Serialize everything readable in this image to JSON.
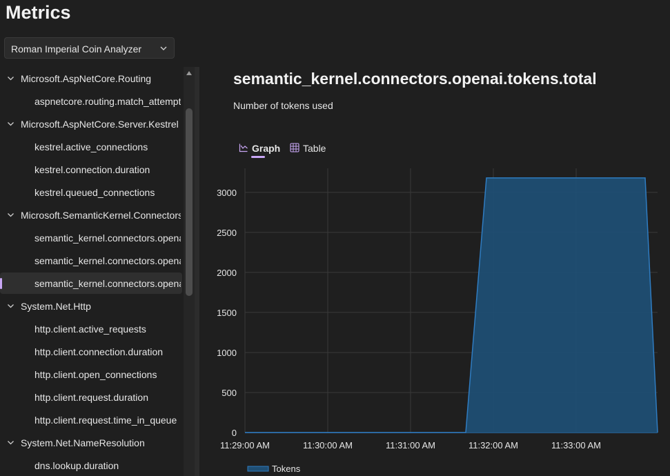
{
  "header": {
    "title": "Metrics"
  },
  "resource_select": {
    "value": "Roman Imperial Coin Analyzer"
  },
  "sidebar": {
    "items": [
      {
        "type": "group",
        "label": "Microsoft.AspNetCore.Routing"
      },
      {
        "type": "leaf",
        "label": "aspnetcore.routing.match_attempts"
      },
      {
        "type": "group",
        "label": "Microsoft.AspNetCore.Server.Kestrel"
      },
      {
        "type": "leaf",
        "label": "kestrel.active_connections"
      },
      {
        "type": "leaf",
        "label": "kestrel.connection.duration"
      },
      {
        "type": "leaf",
        "label": "kestrel.queued_connections"
      },
      {
        "type": "group",
        "label": "Microsoft.SemanticKernel.Connectors.OpenAI"
      },
      {
        "type": "leaf",
        "label": "semantic_kernel.connectors.openai.tokens.prompt"
      },
      {
        "type": "leaf",
        "label": "semantic_kernel.connectors.openai.tokens.completion"
      },
      {
        "type": "leaf",
        "label": "semantic_kernel.connectors.openai.tokens.total",
        "selected": true
      },
      {
        "type": "group",
        "label": "System.Net.Http"
      },
      {
        "type": "leaf",
        "label": "http.client.active_requests"
      },
      {
        "type": "leaf",
        "label": "http.client.connection.duration"
      },
      {
        "type": "leaf",
        "label": "http.client.open_connections"
      },
      {
        "type": "leaf",
        "label": "http.client.request.duration"
      },
      {
        "type": "leaf",
        "label": "http.client.request.time_in_queue"
      },
      {
        "type": "group",
        "label": "System.Net.NameResolution"
      },
      {
        "type": "leaf",
        "label": "dns.lookup.duration"
      }
    ]
  },
  "metric": {
    "title": "semantic_kernel.connectors.openai.tokens.total",
    "description": "Number of tokens used"
  },
  "tabs": {
    "graph": "Graph",
    "table": "Table",
    "active": "graph"
  },
  "colors": {
    "accent": "#c9a7f5",
    "series_fill": "#1f4e73",
    "series_line": "#2f7cc1",
    "grid": "#3a3a3a"
  },
  "chart_data": {
    "type": "area",
    "x": [
      "11:29:00 AM",
      "11:31:40 AM",
      "11:31:55 AM",
      "11:33:50 AM",
      "11:34:05 AM"
    ],
    "x_ticks": [
      "11:29:00 AM",
      "11:30:00 AM",
      "11:31:00 AM",
      "11:32:00 AM",
      "11:33:00 AM"
    ],
    "y_ticks": [
      0,
      500,
      1000,
      1500,
      2000,
      2500,
      3000
    ],
    "ylim": [
      0,
      3300
    ],
    "series": [
      {
        "name": "Tokens",
        "values": [
          0,
          0,
          3180,
          3180,
          0
        ]
      }
    ],
    "legend_position": "bottom-left",
    "grid": true
  }
}
